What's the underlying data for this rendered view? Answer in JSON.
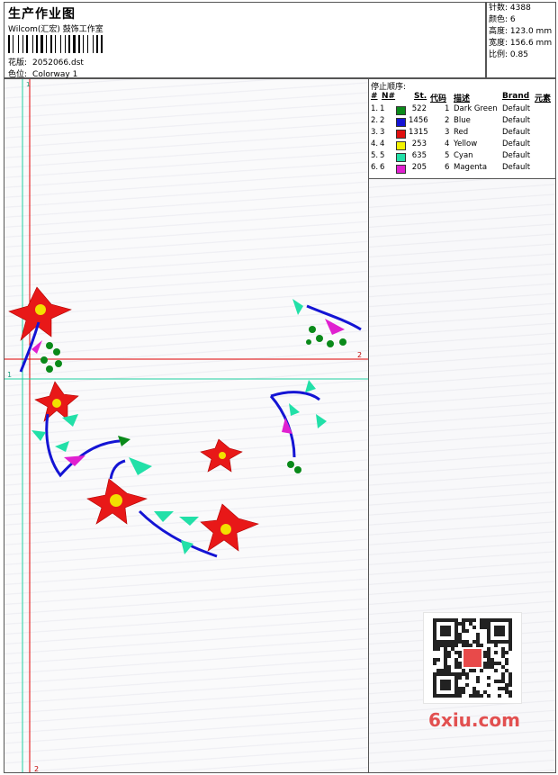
{
  "header": {
    "title": "生产作业图",
    "company": "Wilcom(汇宏) 鼓饰工作室",
    "file_label": "花版:",
    "file_value": "2052066.dst",
    "colorway_label": "色位:",
    "colorway_value": "Colorway 1"
  },
  "stats": [
    {
      "label": "针数:",
      "value": "4388"
    },
    {
      "label": "颜色:",
      "value": "6"
    },
    {
      "label": "高度:",
      "value": "123.0 mm"
    },
    {
      "label": "宽度:",
      "value": "156.6 mm"
    },
    {
      "label": "比例:",
      "value": "0.85"
    }
  ],
  "stop_sequence": {
    "title": "停止顺序:",
    "headers": {
      "num": "#",
      "n": "N#",
      "st": "St.",
      "code": "代码",
      "desc": "描述",
      "brand": "Brand",
      "elem": "元素"
    },
    "rows": [
      {
        "num": "1.",
        "n": "1",
        "st": "522",
        "code": "1",
        "desc": "Dark Green",
        "brand": "Default",
        "color": "#0a8a1a"
      },
      {
        "num": "2.",
        "n": "2",
        "st": "1456",
        "code": "2",
        "desc": "Blue",
        "brand": "Default",
        "color": "#1414d4"
      },
      {
        "num": "3.",
        "n": "3",
        "st": "1315",
        "code": "3",
        "desc": "Red",
        "brand": "Default",
        "color": "#e01010"
      },
      {
        "num": "4.",
        "n": "4",
        "st": "253",
        "code": "4",
        "desc": "Yellow",
        "brand": "Default",
        "color": "#f2f200"
      },
      {
        "num": "5.",
        "n": "5",
        "st": "635",
        "code": "5",
        "desc": "Cyan",
        "brand": "Default",
        "color": "#22e0a8"
      },
      {
        "num": "6.",
        "n": "6",
        "st": "205",
        "code": "6",
        "desc": "Magenta",
        "brand": "Default",
        "color": "#e020d0"
      }
    ]
  },
  "guides": {
    "v1": "1",
    "v2": "2",
    "h1": "1",
    "h2": "2"
  },
  "watermark": "6xiu.com",
  "colors": {
    "red_guide": "#e00000",
    "cyan_guide": "#20d0a0"
  }
}
